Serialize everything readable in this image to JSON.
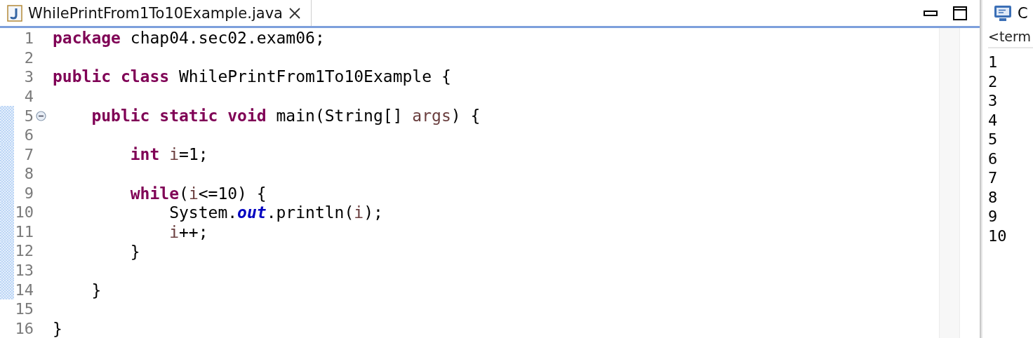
{
  "editor": {
    "tab": {
      "title": "WhilePrintFrom1To10Example.java",
      "selected": true
    },
    "lines": [
      {
        "number": "1",
        "changed": false,
        "foldable": false,
        "tokens": [
          {
            "kind": "keyword",
            "text": "package"
          },
          {
            "kind": "plain",
            "text": " chap04.sec02.exam06;"
          }
        ]
      },
      {
        "number": "2",
        "changed": false,
        "foldable": false
      },
      {
        "number": "3",
        "changed": false,
        "foldable": false,
        "tokens": [
          {
            "kind": "keyword",
            "text": "public class"
          },
          {
            "kind": "plain",
            "text": " WhilePrintFrom1To10Example {"
          }
        ]
      },
      {
        "number": "4",
        "changed": false,
        "foldable": false
      },
      {
        "number": "5",
        "changed": true,
        "foldable": true,
        "tokens": [
          {
            "kind": "keyword",
            "text": "    public static void"
          },
          {
            "kind": "plain",
            "text": " main(String[] "
          },
          {
            "kind": "variable",
            "text": "args"
          },
          {
            "kind": "plain",
            "text": ") {"
          }
        ]
      },
      {
        "number": "6",
        "changed": true,
        "foldable": false
      },
      {
        "number": "7",
        "changed": true,
        "foldable": false,
        "tokens": [
          {
            "kind": "keyword",
            "text": "        int"
          },
          {
            "kind": "variable",
            "text": " i"
          },
          {
            "kind": "plain",
            "text": "=1;"
          }
        ]
      },
      {
        "number": "8",
        "changed": true,
        "foldable": false
      },
      {
        "number": "9",
        "changed": true,
        "foldable": false,
        "tokens": [
          {
            "kind": "keyword",
            "text": "        while"
          },
          {
            "kind": "plain",
            "text": "("
          },
          {
            "kind": "variable",
            "text": "i"
          },
          {
            "kind": "plain",
            "text": "<=10) {"
          }
        ]
      },
      {
        "number": "10",
        "changed": true,
        "foldable": false,
        "tokens": [
          {
            "kind": "plain",
            "text": "            System."
          },
          {
            "kind": "field",
            "text": "out"
          },
          {
            "kind": "plain",
            "text": ".println("
          },
          {
            "kind": "variable",
            "text": "i"
          },
          {
            "kind": "plain",
            "text": ");"
          }
        ]
      },
      {
        "number": "11",
        "changed": true,
        "foldable": false,
        "tokens": [
          {
            "kind": "variable",
            "text": "            i"
          },
          {
            "kind": "plain",
            "text": "++;"
          }
        ]
      },
      {
        "number": "12",
        "changed": true,
        "foldable": false,
        "tokens": [
          {
            "kind": "plain",
            "text": "        }"
          }
        ]
      },
      {
        "number": "13",
        "changed": true,
        "foldable": false
      },
      {
        "number": "14",
        "changed": true,
        "foldable": false,
        "tokens": [
          {
            "kind": "plain",
            "text": "    }"
          }
        ]
      },
      {
        "number": "15",
        "changed": false,
        "foldable": false
      },
      {
        "number": "16",
        "changed": false,
        "foldable": false,
        "tokens": [
          {
            "kind": "plain",
            "text": "}"
          }
        ]
      }
    ]
  },
  "console": {
    "title": "C",
    "subtitle": "<term",
    "output": [
      "1",
      "2",
      "3",
      "4",
      "5",
      "6",
      "7",
      "8",
      "9",
      "10"
    ]
  }
}
